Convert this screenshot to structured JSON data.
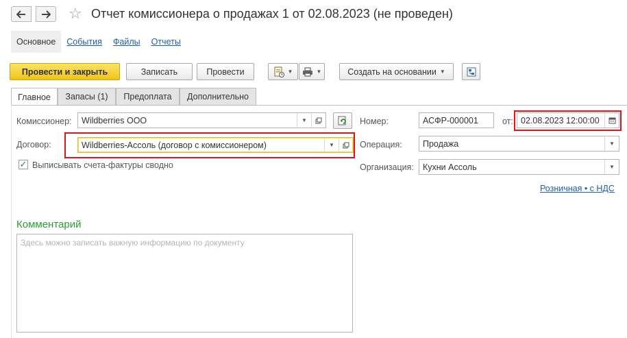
{
  "window": {
    "title": "Отчет комиссионера о продажах 1 от 02.08.2023 (не проведен)"
  },
  "top_tabs": [
    {
      "label": "Основное",
      "active": true
    },
    {
      "label": "События",
      "active": false
    },
    {
      "label": "Файлы",
      "active": false
    },
    {
      "label": "Отчеты",
      "active": false
    }
  ],
  "toolbar": {
    "post_close_label": "Провести и закрыть",
    "save_label": "Записать",
    "post_label": "Провести",
    "create_based_label": "Создать на основании"
  },
  "form_tabs": [
    {
      "label": "Главное",
      "active": true
    },
    {
      "label": "Запасы (1)",
      "active": false
    },
    {
      "label": "Предоплата",
      "active": false
    },
    {
      "label": "Дополнительно",
      "active": false
    }
  ],
  "fields": {
    "commissioner_label": "Комиссионер:",
    "commissioner_value": "Wildberries ООО",
    "contract_label": "Договор:",
    "contract_value": "Wildberries-Ассоль (договор с комиссионером)",
    "invoice_summary_label": "Выписывать счета-фактуры сводно",
    "invoice_summary_checked": true,
    "number_label": "Номер:",
    "number_value": "АСФР-000001",
    "date_label": "от:",
    "date_value": "02.08.2023 12:00:00",
    "operation_label": "Операция:",
    "operation_value": "Продажа",
    "organization_label": "Организация:",
    "organization_value": "Кухни Ассоль",
    "tax_link": "Розничная • с НДС"
  },
  "comment": {
    "title": "Комментарий",
    "placeholder": "Здесь можно записать важную информацию по документу"
  },
  "colors": {
    "primary_button": "#f0c419",
    "highlight_box": "#d9141b",
    "link": "#1f5fa8",
    "comment_title": "#2e9a3a"
  }
}
